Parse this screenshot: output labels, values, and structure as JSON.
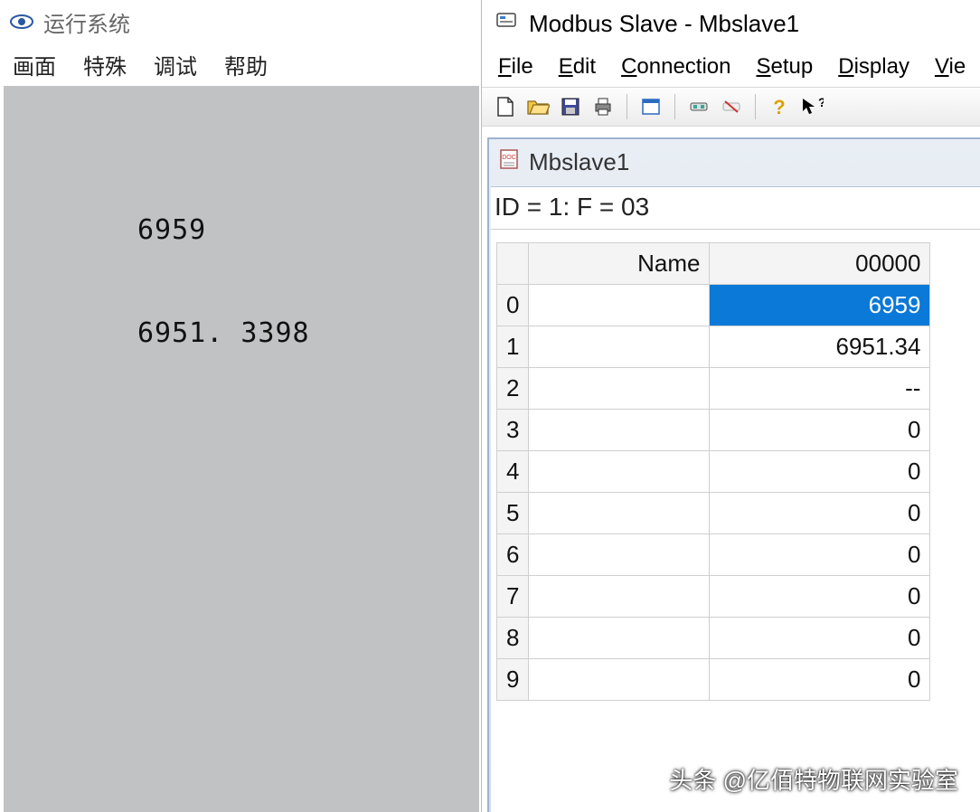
{
  "left": {
    "title": "运行系统",
    "menu": [
      "画面",
      "特殊",
      "调试",
      "帮助"
    ],
    "values": {
      "v1": "6959",
      "v2": "6951. 3398"
    }
  },
  "right": {
    "title": "Modbus Slave - Mbslave1",
    "menu": [
      {
        "label": "File",
        "ukey": "F"
      },
      {
        "label": "Edit",
        "ukey": "E"
      },
      {
        "label": "Connection",
        "ukey": "C"
      },
      {
        "label": "Setup",
        "ukey": "S"
      },
      {
        "label": "Display",
        "ukey": "D"
      },
      {
        "label": "View",
        "ukey": "V",
        "truncated": "Vie"
      }
    ],
    "toolbar_icons": [
      "new",
      "open",
      "save",
      "print",
      "sep",
      "window",
      "sep",
      "connect",
      "disconnect",
      "sep",
      "help",
      "whatsthis"
    ],
    "child_title": "Mbslave1",
    "status_line": "ID = 1: F = 03",
    "grid": {
      "columns": [
        "Name",
        "00000"
      ],
      "rows": [
        {
          "idx": "0",
          "name": "",
          "value": "6959",
          "selected": true
        },
        {
          "idx": "1",
          "name": "",
          "value": "6951.34"
        },
        {
          "idx": "2",
          "name": "",
          "value": "--"
        },
        {
          "idx": "3",
          "name": "",
          "value": "0"
        },
        {
          "idx": "4",
          "name": "",
          "value": "0"
        },
        {
          "idx": "5",
          "name": "",
          "value": "0"
        },
        {
          "idx": "6",
          "name": "",
          "value": "0"
        },
        {
          "idx": "7",
          "name": "",
          "value": "0"
        },
        {
          "idx": "8",
          "name": "",
          "value": "0"
        },
        {
          "idx": "9",
          "name": "",
          "value": "0"
        }
      ]
    }
  },
  "watermark": "头条 @亿佰特物联网实验室"
}
